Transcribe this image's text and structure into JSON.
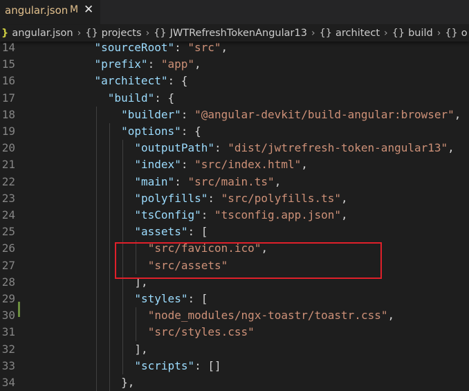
{
  "tab": {
    "filename": "angular.json",
    "status": "M",
    "close": "✕"
  },
  "breadcrumbs": [
    {
      "icon": "{}",
      "label": "angular.json"
    },
    {
      "icon": "{}",
      "label": "projects"
    },
    {
      "icon": "{}",
      "label": "JWTRefreshTokenAngular13"
    },
    {
      "icon": "{}",
      "label": "architect"
    },
    {
      "icon": "{}",
      "label": "build"
    },
    {
      "icon": "{}",
      "label": "o"
    }
  ],
  "lines": [
    {
      "n": "14",
      "indent": 5,
      "tokens": [
        [
          "k",
          "\"sourceRoot\""
        ],
        [
          "p",
          ": "
        ],
        [
          "s",
          "\"src\""
        ],
        [
          "p",
          ","
        ]
      ]
    },
    {
      "n": "15",
      "indent": 5,
      "tokens": [
        [
          "k",
          "\"prefix\""
        ],
        [
          "p",
          ": "
        ],
        [
          "s",
          "\"app\""
        ],
        [
          "p",
          ","
        ]
      ]
    },
    {
      "n": "16",
      "indent": 5,
      "tokens": [
        [
          "k",
          "\"architect\""
        ],
        [
          "p",
          ": {"
        ]
      ]
    },
    {
      "n": "17",
      "indent": 6,
      "tokens": [
        [
          "k",
          "\"build\""
        ],
        [
          "p",
          ": {"
        ]
      ]
    },
    {
      "n": "18",
      "indent": 7,
      "tokens": [
        [
          "k",
          "\"builder\""
        ],
        [
          "p",
          ": "
        ],
        [
          "s",
          "\"@angular-devkit/build-angular:browser\""
        ],
        [
          "p",
          ","
        ]
      ]
    },
    {
      "n": "19",
      "indent": 7,
      "tokens": [
        [
          "k",
          "\"options\""
        ],
        [
          "p",
          ": {"
        ]
      ]
    },
    {
      "n": "20",
      "indent": 8,
      "tokens": [
        [
          "k",
          "\"outputPath\""
        ],
        [
          "p",
          ": "
        ],
        [
          "s",
          "\"dist/jwtrefresh-token-angular13\""
        ],
        [
          "p",
          ","
        ]
      ]
    },
    {
      "n": "21",
      "indent": 8,
      "tokens": [
        [
          "k",
          "\"index\""
        ],
        [
          "p",
          ": "
        ],
        [
          "s",
          "\"src/index.html\""
        ],
        [
          "p",
          ","
        ]
      ]
    },
    {
      "n": "22",
      "indent": 8,
      "tokens": [
        [
          "k",
          "\"main\""
        ],
        [
          "p",
          ": "
        ],
        [
          "s",
          "\"src/main.ts\""
        ],
        [
          "p",
          ","
        ]
      ]
    },
    {
      "n": "23",
      "indent": 8,
      "tokens": [
        [
          "k",
          "\"polyfills\""
        ],
        [
          "p",
          ": "
        ],
        [
          "s",
          "\"src/polyfills.ts\""
        ],
        [
          "p",
          ","
        ]
      ]
    },
    {
      "n": "24",
      "indent": 8,
      "tokens": [
        [
          "k",
          "\"tsConfig\""
        ],
        [
          "p",
          ": "
        ],
        [
          "s",
          "\"tsconfig.app.json\""
        ],
        [
          "p",
          ","
        ]
      ]
    },
    {
      "n": "25",
      "indent": 8,
      "tokens": [
        [
          "k",
          "\"assets\""
        ],
        [
          "p",
          ": ["
        ]
      ]
    },
    {
      "n": "26",
      "indent": 9,
      "tokens": [
        [
          "s",
          "\"src/favicon.ico\""
        ],
        [
          "p",
          ","
        ]
      ]
    },
    {
      "n": "27",
      "indent": 9,
      "tokens": [
        [
          "s",
          "\"src/assets\""
        ]
      ]
    },
    {
      "n": "28",
      "indent": 8,
      "tokens": [
        [
          "p",
          "],"
        ]
      ]
    },
    {
      "n": "29",
      "indent": 8,
      "tokens": [
        [
          "k",
          "\"styles\""
        ],
        [
          "p",
          ": ["
        ]
      ]
    },
    {
      "n": "30",
      "indent": 9,
      "tokens": [
        [
          "s",
          "\"node_modules/ngx-toastr/toastr.css\""
        ],
        [
          "p",
          ","
        ]
      ]
    },
    {
      "n": "31",
      "indent": 9,
      "tokens": [
        [
          "s",
          "\"src/styles.css\""
        ]
      ]
    },
    {
      "n": "32",
      "indent": 8,
      "tokens": [
        [
          "p",
          "],"
        ]
      ]
    },
    {
      "n": "33",
      "indent": 8,
      "tokens": [
        [
          "k",
          "\"scripts\""
        ],
        [
          "p",
          ": []"
        ]
      ]
    },
    {
      "n": "34",
      "indent": 7,
      "tokens": [
        [
          "p",
          "},"
        ]
      ]
    }
  ],
  "colors": {
    "key": "#9cdcfe",
    "string": "#ce9178",
    "punct": "#d4d4d4",
    "highlight": "#e0202a",
    "modified": "#e2c08d"
  }
}
